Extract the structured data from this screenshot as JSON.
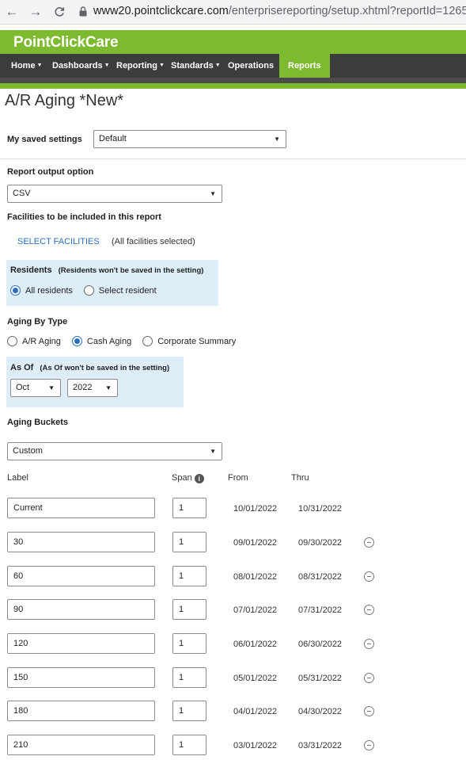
{
  "browser": {
    "back": "←",
    "forward": "→",
    "reload": "C",
    "url_host": "www20.pointclickcare.com",
    "url_path": "/enterprisereporting/setup.xhtml?reportId=1265"
  },
  "app": {
    "logo": "PointClickCare",
    "nav": [
      {
        "label": "Home",
        "caret": "▼"
      },
      {
        "label": "Dashboards",
        "caret": "▼"
      },
      {
        "label": "Reporting",
        "caret": "▼"
      },
      {
        "label": "Standards",
        "caret": "▼"
      },
      {
        "label": "Operations",
        "caret": ""
      },
      {
        "label": "Reports",
        "caret": ""
      }
    ],
    "active_nav_color": "#7dba2f",
    "brand_color": "#7dba2f",
    "nav_bg_color": "#3c3c3c"
  },
  "page": {
    "title": "A/R Aging *New*",
    "saved_settings_label": "My saved settings",
    "saved_settings_value": "Default",
    "output_label": "Report output option",
    "output_value": "CSV",
    "facilities_label": "Facilities to be included in this report",
    "select_facilities": "SELECT FACILITIES",
    "facilities_note": "(All facilities selected)",
    "residents_label": "Residents",
    "residents_note": "(Residents won't be saved in the setting)",
    "residents_options": [
      "All residents",
      "Select resident"
    ],
    "residents_selected": "All residents",
    "aging_type_label": "Aging By Type",
    "aging_type_options": [
      "A/R Aging",
      "Cash Aging",
      "Corporate Summary"
    ],
    "aging_type_selected": "Cash Aging",
    "as_of_label": "As Of",
    "as_of_note": "(As Of won't be saved in the setting)",
    "as_of_month": "Oct",
    "as_of_year": "2022",
    "buckets_label": "Aging Buckets",
    "buckets_value": "Custom",
    "columns": {
      "label": "Label",
      "span": "Span",
      "from": "From",
      "thru": "Thru"
    }
  },
  "buckets": [
    {
      "label": "Current",
      "span": "1",
      "from": "10/01/2022",
      "thru": "10/31/2022",
      "removable": false
    },
    {
      "label": "30",
      "span": "1",
      "from": "09/01/2022",
      "thru": "09/30/2022",
      "removable": true
    },
    {
      "label": "60",
      "span": "1",
      "from": "08/01/2022",
      "thru": "08/31/2022",
      "removable": true
    },
    {
      "label": "90",
      "span": "1",
      "from": "07/01/2022",
      "thru": "07/31/2022",
      "removable": true
    },
    {
      "label": "120",
      "span": "1",
      "from": "06/01/2022",
      "thru": "06/30/2022",
      "removable": true
    },
    {
      "label": "150",
      "span": "1",
      "from": "05/01/2022",
      "thru": "05/31/2022",
      "removable": true
    },
    {
      "label": "180",
      "span": "1",
      "from": "04/01/2022",
      "thru": "04/30/2022",
      "removable": true
    },
    {
      "label": "210",
      "span": "1",
      "from": "03/01/2022",
      "thru": "03/31/2022",
      "removable": true
    }
  ]
}
